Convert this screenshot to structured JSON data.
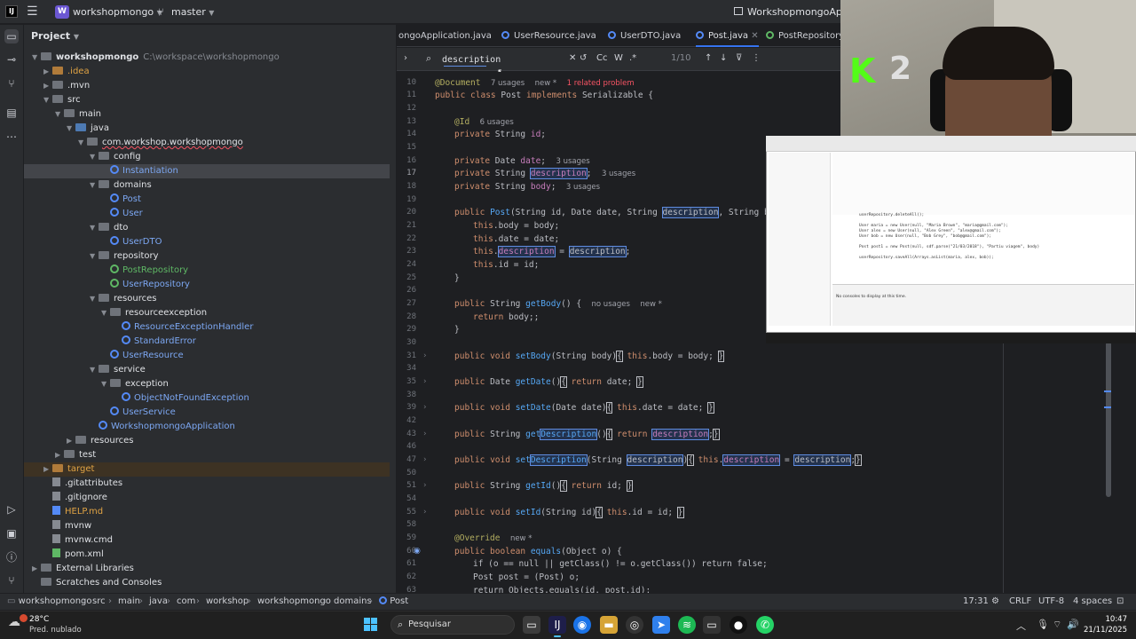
{
  "titlebar": {
    "project_badge": "W",
    "project_name": "workshopmongo",
    "branch": "master",
    "window_title": "WorkshopmongoApplica"
  },
  "project_panel": {
    "header": "Project",
    "tree": [
      {
        "label": "workshopmongo",
        "extra": "C:\\workspace\\workshopmongo"
      },
      {
        "label": ".idea"
      },
      {
        "label": ".mvn"
      },
      {
        "label": "src"
      },
      {
        "label": "main"
      },
      {
        "label": "java"
      },
      {
        "label": "com.workshop.workshopmongo"
      },
      {
        "label": "config"
      },
      {
        "label": "Instantiation"
      },
      {
        "label": "domains"
      },
      {
        "label": "Post"
      },
      {
        "label": "User"
      },
      {
        "label": "dto"
      },
      {
        "label": "UserDTO"
      },
      {
        "label": "repository"
      },
      {
        "label": "PostRepository"
      },
      {
        "label": "UserRepository"
      },
      {
        "label": "resources"
      },
      {
        "label": "resourceexception"
      },
      {
        "label": "ResourceExceptionHandler"
      },
      {
        "label": "StandardError"
      },
      {
        "label": "UserResource"
      },
      {
        "label": "service"
      },
      {
        "label": "exception"
      },
      {
        "label": "ObjectNotFoundException"
      },
      {
        "label": "UserService"
      },
      {
        "label": "WorkshopmongoApplication"
      },
      {
        "label": "resources"
      },
      {
        "label": "test"
      },
      {
        "label": "target"
      },
      {
        "label": ".gitattributes"
      },
      {
        "label": ".gitignore"
      },
      {
        "label": "HELP.md"
      },
      {
        "label": "mvnw"
      },
      {
        "label": "mvnw.cmd"
      },
      {
        "label": "pom.xml"
      },
      {
        "label": "External Libraries"
      },
      {
        "label": "Scratches and Consoles"
      }
    ]
  },
  "tabs": [
    "ongoApplication.java",
    "UserResource.java",
    "UserDTO.java",
    "Post.java",
    "PostRepository.ja"
  ],
  "find": {
    "query": "description",
    "match_case": "Cc",
    "words": "W",
    "regex": ".*",
    "count": "1/10"
  },
  "code": {
    "line_numbers": [
      "10",
      "11",
      "12",
      "13",
      "14",
      "15",
      "16",
      "17",
      "18",
      "19",
      "20",
      "21",
      "22",
      "23",
      "24",
      "25",
      "26",
      "27",
      "28",
      "29",
      "30",
      "31",
      "34",
      "35",
      "38",
      "39",
      "42",
      "43",
      "46",
      "47",
      "50",
      "51",
      "54",
      "55",
      "58",
      "59",
      "60",
      "61",
      "62",
      "63"
    ],
    "hints": {
      "doc_usages": "7 usages",
      "new": "new *",
      "problem": "1 related problem",
      "id_usages": "6 usages",
      "three_usages": "3 usages",
      "no_usages": "no usages"
    },
    "l10": "@Document",
    "l11_kw": "public class",
    "l11_name": "Post",
    "l11_kw2": "implements",
    "l11_rest": "Serializable {",
    "l13": "@Id",
    "l14_kw": "private",
    "l14_rest": "String",
    "l14_fld": "id",
    "l16_fld": "date",
    "l17_fld": "description",
    "l18_fld": "body",
    "date_type": "Date",
    "l20_ctor": "Post",
    "l20_params": "(String id, Date date, String ",
    "l20_params2": ", String body) {",
    "this_kw": "this",
    "l21": ".body = body;",
    "l22": ".date = date;",
    "l23_rest": " = ",
    "l24": ".id = id;",
    "close_brace": "}",
    "l27_kw": "public",
    "l27_type": "String",
    "l27_name": "getBody",
    "l27_rest": "() {",
    "l28_kw": "return",
    "l28_rest": " body;",
    "void_kw": "void",
    "l31_name": "setBody",
    "l31_rest": "(String body)",
    "l31_body": ".body = body;",
    "l35_name": "getDate",
    "l35_body": "date;",
    "l39_name": "setDate",
    "l39_rest": "(Date date)",
    "l39_body": ".date = date;",
    "get_prefix": "get",
    "set_prefix": "set",
    "desc_cap": "Description",
    "l47_rest": "(String ",
    "l51_name": "getId",
    "l51_body": "id;",
    "l55_name": "setId",
    "l55_rest": "(String id)",
    "l55_body": ".id = id;",
    "l59": "@Override",
    "l60_kw": "public boolean",
    "l60_name": "equals",
    "l60_rest": "(Object o) {",
    "l61": "if (o == null || getClass() != o.getClass()) return false;",
    "l62": "Post post = (Post) o;",
    "l63": "return Objects.equals(id, post.id);"
  },
  "overlay": {
    "badge_letter": "K",
    "badge_number": "2",
    "inset_code": "userRepository.deleteAll();\n\nUser maria = new User(null, \"Maria Brown\", \"maria@gmail.com\");\nUser alex = new User(null, \"Alex Green\", \"alex@gmail.com\");\nUser bob = new User(null, \"Bob Grey\", \"bob@gmail.com\");\n\nPost post1 = new Post(null, sdf.parse(\"21/03/2018\"), \"Partiu viagem\", body)\n\nuserRepository.saveAll(Arrays.asList(maria, alex, bob));",
    "inset_console": "No consoles to display at this time."
  },
  "statusbar": {
    "crumbs": [
      "workshopmongo",
      "src",
      "main",
      "java",
      "com",
      "workshop",
      "workshopmongo",
      "domains",
      "Post"
    ],
    "position": "17:31",
    "line_sep": "CRLF",
    "encoding": "UTF-8",
    "indent": "4 spaces"
  },
  "taskbar": {
    "temp": "28°C",
    "condition": "Pred. nublado",
    "search": "Pesquisar",
    "time": "10:47",
    "date": "21/11/2025"
  },
  "colors": {
    "accent": "#3574f0",
    "keyword": "#cf8e6d",
    "field": "#c77dbb",
    "method": "#56a8f5"
  }
}
